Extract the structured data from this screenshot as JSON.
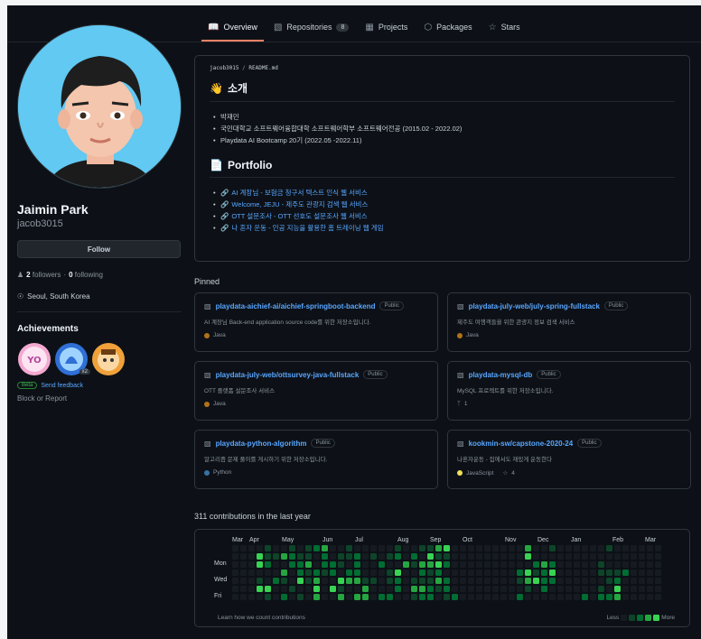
{
  "tabs": [
    {
      "label": "Overview",
      "icon": "book-icon",
      "active": true
    },
    {
      "label": "Repositories",
      "icon": "repo-icon",
      "count": "8"
    },
    {
      "label": "Projects",
      "icon": "table-icon"
    },
    {
      "label": "Packages",
      "icon": "package-icon"
    },
    {
      "label": "Stars",
      "icon": "star-icon"
    }
  ],
  "profile": {
    "name": "Jaimin Park",
    "login": "jacob3015",
    "follow_label": "Follow",
    "followers": "2",
    "followers_label": "followers",
    "following": "0",
    "following_label": "following",
    "location": "Seoul, South Korea"
  },
  "achievements": {
    "title": "Achievements",
    "badge_multiplier": "x2",
    "beta": "Beta",
    "feedback": "Send feedback",
    "block": "Block or Report"
  },
  "readme": {
    "path_user": "jacob3015",
    "path_file": "README.md",
    "intro_heading": "소개",
    "intro_items": [
      "박재민",
      "국민대학교 소프트웨어융합대학 소프트웨어학부 소프트웨어전공 (2015.02 - 2022.02)",
      "Playdata AI Bootcamp 20기 (2022.05 -2022.11)"
    ],
    "portfolio_heading": "Portfolio",
    "portfolio_items": [
      "AI 계장님 - 보험금 청구서 텍스트 인식 웹 서비스",
      "Welcome, JEJU - 제주도 관광지 검색 웹 서비스",
      "OTT 설문조사 - OTT 선호도 설문조사 웹 서비스",
      "나 혼자 운동 - 인공 지능을 활용한 홈 트레이닝 웹 게임"
    ]
  },
  "pinned": {
    "title": "Pinned",
    "public_label": "Public",
    "repos": [
      {
        "name": "playdata-aichief-ai/aichief-springboot-backend",
        "desc": "AI 계장님 Back-end application source code를 위한 저장소입니다.",
        "lang": "Java",
        "lang_color": "#b07219"
      },
      {
        "name": "playdata-july-web/july-spring-fullstack",
        "desc": "제주도 여행객들을 위한 관광지 정보 검색 서비스",
        "lang": "Java",
        "lang_color": "#b07219"
      },
      {
        "name": "playdata-july-web/ottsurvey-java-fullstack",
        "desc": "OTT 플랫폼 설문조사 서비스",
        "lang": "Java",
        "lang_color": "#b07219"
      },
      {
        "name": "playdata-mysql-db",
        "desc": "MySQL 프로젝트를 위한 저장소입니다.",
        "forks": "1"
      },
      {
        "name": "playdata-python-algorithm",
        "desc": "알고리즘 문제 풀이를 게시하기 위한 저장소입니다.",
        "lang": "Python",
        "lang_color": "#3572a5"
      },
      {
        "name": "kookmin-sw/capstone-2020-24",
        "desc": "나혼자운동 - 집에서도 재밌게 운동한다",
        "lang": "JavaScript",
        "lang_color": "#f1e05a",
        "stars": "4"
      }
    ]
  },
  "contributions": {
    "title": "311 contributions in the last year",
    "months": [
      "Mar",
      "Apr",
      "May",
      "Jun",
      "Jul",
      "Aug",
      "Sep",
      "Oct",
      "Nov",
      "Dec",
      "Jan",
      "Feb",
      "Mar"
    ],
    "days": [
      "Mon",
      "Wed",
      "Fri"
    ],
    "learn": "Learn how we count contributions",
    "less": "Less",
    "more": "More",
    "colors": [
      "#161b22",
      "#0e4429",
      "#006d32",
      "#26a641",
      "#39d353"
    ]
  }
}
